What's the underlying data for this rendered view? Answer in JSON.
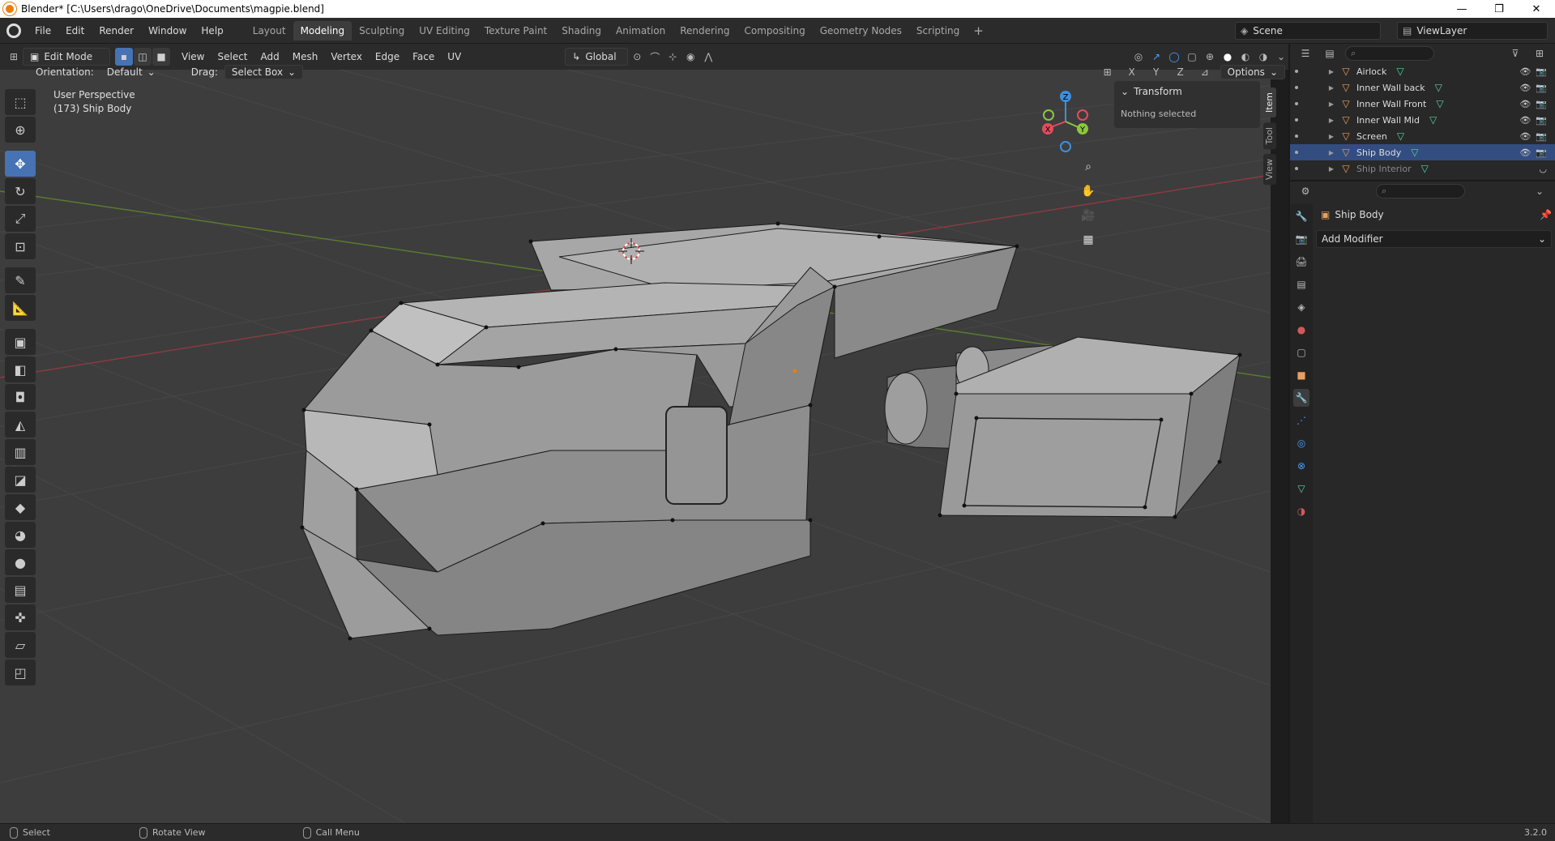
{
  "window": {
    "title": "Blender* [C:\\Users\\drago\\OneDrive\\Documents\\magpie.blend]",
    "minimize": "—",
    "maximize": "❐",
    "close": "✕"
  },
  "menu": [
    "File",
    "Edit",
    "Render",
    "Window",
    "Help"
  ],
  "workspaces": [
    "Layout",
    "Modeling",
    "Sculpting",
    "UV Editing",
    "Texture Paint",
    "Shading",
    "Animation",
    "Rendering",
    "Compositing",
    "Geometry Nodes",
    "Scripting"
  ],
  "active_workspace": "Modeling",
  "scene": {
    "label": "Scene"
  },
  "view_layer": {
    "label": "ViewLayer"
  },
  "viewport_header": {
    "mode": "Edit Mode",
    "menus": [
      "View",
      "Select",
      "Add",
      "Mesh",
      "Vertex",
      "Edge",
      "Face",
      "UV"
    ],
    "transform_orientation": "Global"
  },
  "tool_settings": {
    "orientation_label": "Orientation:",
    "orientation_value": "Default",
    "drag_label": "Drag:",
    "drag_value": "Select Box",
    "axes": [
      "X",
      "Y",
      "Z"
    ],
    "options": "Options"
  },
  "viewport": {
    "view_name": "User Perspective",
    "object_info": "(173) Ship Body"
  },
  "gizmo": {
    "x": "X",
    "y": "Y",
    "z": "Z"
  },
  "npanel": {
    "section": "Transform",
    "message": "Nothing selected",
    "tabs": [
      "Item",
      "Tool",
      "View"
    ]
  },
  "outliner": {
    "items": [
      {
        "name": "Airlock",
        "selected": false,
        "dim": false
      },
      {
        "name": "Inner Wall back",
        "selected": false,
        "dim": false
      },
      {
        "name": "Inner Wall Front",
        "selected": false,
        "dim": false
      },
      {
        "name": "Inner Wall Mid",
        "selected": false,
        "dim": false
      },
      {
        "name": "Screen",
        "selected": false,
        "dim": false
      },
      {
        "name": "Ship Body",
        "selected": true,
        "dim": false
      },
      {
        "name": "Ship Interior",
        "selected": false,
        "dim": true
      }
    ]
  },
  "properties": {
    "object_name": "Ship Body",
    "add_modifier": "Add Modifier"
  },
  "status": {
    "select": "Select",
    "rotate": "Rotate View",
    "call_menu": "Call Menu",
    "version": "3.2.0"
  },
  "colors": {
    "accent": "#4772b3",
    "viewport_bg": "#3d3d3d",
    "mesh_face": "#8c8c8c",
    "x_axis": "#e04e5f",
    "y_axis": "#8cc63f",
    "z_axis": "#3d8fe0"
  }
}
